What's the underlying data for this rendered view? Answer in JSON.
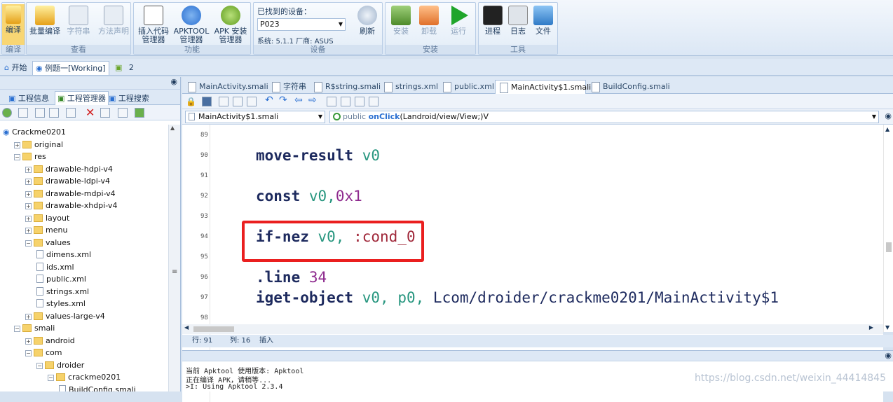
{
  "ribbon": {
    "groups": [
      {
        "label": "编译",
        "buttons": [
          "编译"
        ]
      },
      {
        "label": "查看",
        "buttons": [
          "批量编译",
          "字符串",
          "方法声明"
        ]
      },
      {
        "label": "功能",
        "buttons": [
          "插入代码管理器",
          "APKTOOL管理器",
          "APK 安装管理器"
        ]
      },
      {
        "label": "设备",
        "device_label": "已找到的设备：",
        "device": "P023",
        "sys": "系统: 5.1.1  厂商: ASUS",
        "refresh": "刷新"
      },
      {
        "label": "安装",
        "buttons": [
          "安装",
          "卸载",
          "运行"
        ]
      },
      {
        "label": "工具",
        "buttons": [
          "进程",
          "日志",
          "文件"
        ]
      }
    ]
  },
  "top_tabs": {
    "start": "开始",
    "project": "例题一[Working]",
    "count": "2"
  },
  "left_panel": {
    "tabs": [
      "工程信息",
      "工程管理器",
      "工程搜索"
    ],
    "tree": [
      {
        "label": "Crackme0201",
        "depth": 0,
        "type": "root"
      },
      {
        "label": "original",
        "depth": 1,
        "type": "folder"
      },
      {
        "label": "res",
        "depth": 1,
        "type": "folder"
      },
      {
        "label": "drawable-hdpi-v4",
        "depth": 2,
        "type": "folder"
      },
      {
        "label": "drawable-ldpi-v4",
        "depth": 2,
        "type": "folder"
      },
      {
        "label": "drawable-mdpi-v4",
        "depth": 2,
        "type": "folder"
      },
      {
        "label": "drawable-xhdpi-v4",
        "depth": 2,
        "type": "folder"
      },
      {
        "label": "layout",
        "depth": 2,
        "type": "folder"
      },
      {
        "label": "menu",
        "depth": 2,
        "type": "folder"
      },
      {
        "label": "values",
        "depth": 2,
        "type": "folder"
      },
      {
        "label": "dimens.xml",
        "depth": 3,
        "type": "file"
      },
      {
        "label": "ids.xml",
        "depth": 3,
        "type": "file"
      },
      {
        "label": "public.xml",
        "depth": 3,
        "type": "file"
      },
      {
        "label": "strings.xml",
        "depth": 3,
        "type": "file"
      },
      {
        "label": "styles.xml",
        "depth": 3,
        "type": "file"
      },
      {
        "label": "values-large-v4",
        "depth": 2,
        "type": "folder"
      },
      {
        "label": "smali",
        "depth": 1,
        "type": "folder"
      },
      {
        "label": "android",
        "depth": 2,
        "type": "folder"
      },
      {
        "label": "com",
        "depth": 2,
        "type": "folder"
      },
      {
        "label": "droider",
        "depth": 3,
        "type": "folder"
      },
      {
        "label": "crackme0201",
        "depth": 4,
        "type": "folder"
      },
      {
        "label": "BuildConfig.smali",
        "depth": 5,
        "type": "file"
      }
    ]
  },
  "editor": {
    "tabs": [
      "MainActivity.smali",
      "字符串",
      "R$string.smali",
      "strings.xml",
      "public.xml",
      "MainActivity$1.smali",
      "BuildConfig.smali"
    ],
    "active_tab": "MainActivity$1.smali",
    "file_combo": "MainActivity$1.smali",
    "method_combo_prefix": "public",
    "method_combo_name": "onClick",
    "method_combo_sig": "(Landroid/view/View;)V",
    "line_numbers": [
      "89",
      "90",
      "91",
      "92",
      "93",
      "94",
      "95",
      "96",
      "97",
      "98"
    ],
    "lines": {
      "l90_kw": "move-result",
      "l90_reg": "v0",
      "l92_kw": "const",
      "l92_reg": "v0,",
      "l92_num": "0x1",
      "l94_kw": "if-nez",
      "l94_reg": "v0,",
      "l94_label": ":cond_0",
      "l96_kw": ".line",
      "l96_num": "34",
      "l97_kw": "iget-object",
      "l97_reg1": "v0,",
      "l97_reg2": "p0,",
      "l97_text": "Lcom/droider/crackme0201/MainActivity$1"
    }
  },
  "status": {
    "row": "行: 91",
    "col": "列: 16",
    "mode": "插入"
  },
  "console": {
    "lines": [
      "当前 Apktool 使用版本: Apktool",
      "正在编译 APK，请稍等...",
      ">I: Using Apktool 2.3.4"
    ]
  },
  "watermark": "https://blog.csdn.net/weixin_44414845"
}
